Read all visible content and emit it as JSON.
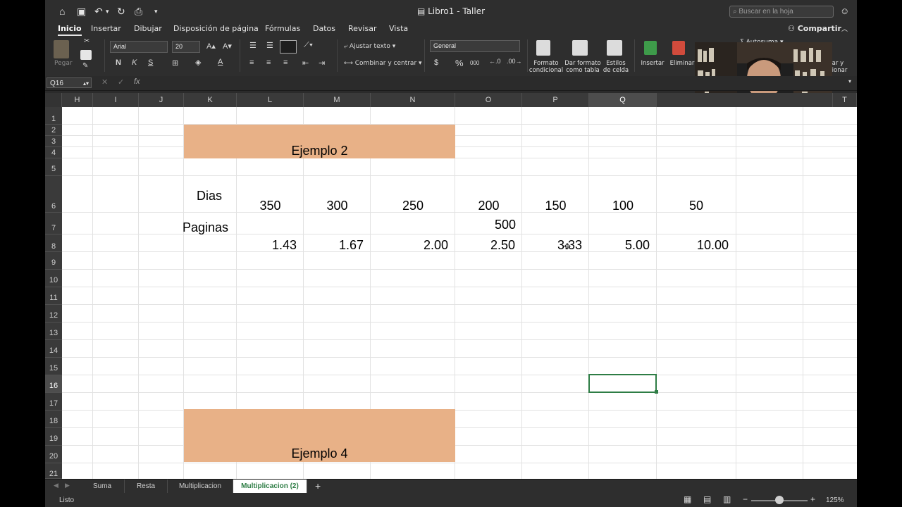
{
  "window": {
    "title": "Libro1 - Taller",
    "search_placeholder": "Buscar en la hoja"
  },
  "ribbon_tabs": [
    "Inicio",
    "Insertar",
    "Dibujar",
    "Disposición de página",
    "Fórmulas",
    "Datos",
    "Revisar",
    "Vista"
  ],
  "share_label": "Compartir",
  "ribbon": {
    "paste": "Pegar",
    "font": "Arial",
    "font_size": "20",
    "bold": "N",
    "italic": "K",
    "underline": "S",
    "wrap_text": "Ajustar texto",
    "merge_center": "Combinar y centrar",
    "number_format": "General",
    "currency": "$",
    "percent": "%",
    "thousands": "000",
    "cond_format": [
      "Formato",
      "condicional"
    ],
    "format_table": [
      "Dar formato",
      "como tabla"
    ],
    "cell_styles": [
      "Estilos",
      "de celda"
    ],
    "insert": "Insertar",
    "delete": "Eliminar",
    "autosum": "Autosuma",
    "find_select": [
      "car y",
      "cionar"
    ]
  },
  "formula_bar": {
    "name_box": "Q16",
    "fx": "fx",
    "value": ""
  },
  "columns": [
    "H",
    "I",
    "J",
    "K",
    "L",
    "M",
    "N",
    "O",
    "P",
    "Q",
    "T"
  ],
  "selected_column": "Q",
  "rows": [
    "1",
    "2",
    "3",
    "4",
    "5",
    "6",
    "7",
    "8",
    "9",
    "10",
    "11",
    "12",
    "13",
    "14",
    "15",
    "16",
    "17",
    "18",
    "19",
    "20",
    "21"
  ],
  "selected_row": "16",
  "cells": {
    "ejemplo2": "Ejemplo 2",
    "dias_label": "Dias",
    "dias_values": [
      "350",
      "300",
      "250",
      "200",
      "150",
      "100",
      "50"
    ],
    "paginas_label": "Paginas",
    "paginas_value": "500",
    "result_values": [
      "1.43",
      "1.67",
      "2.00",
      "2.50",
      "3.33",
      "5.00",
      "10.00"
    ],
    "ejemplo4": "Ejemplo 4"
  },
  "sheet_tabs": [
    "Suma",
    "Resta",
    "Multiplicacion",
    "Multiplicacion (2)"
  ],
  "active_sheet": "Multiplicacion (2)",
  "status": {
    "text": "Listo",
    "zoom": "125%"
  },
  "colors": {
    "fill_orange": "#e8b187",
    "selection_green": "#2e7d45"
  }
}
